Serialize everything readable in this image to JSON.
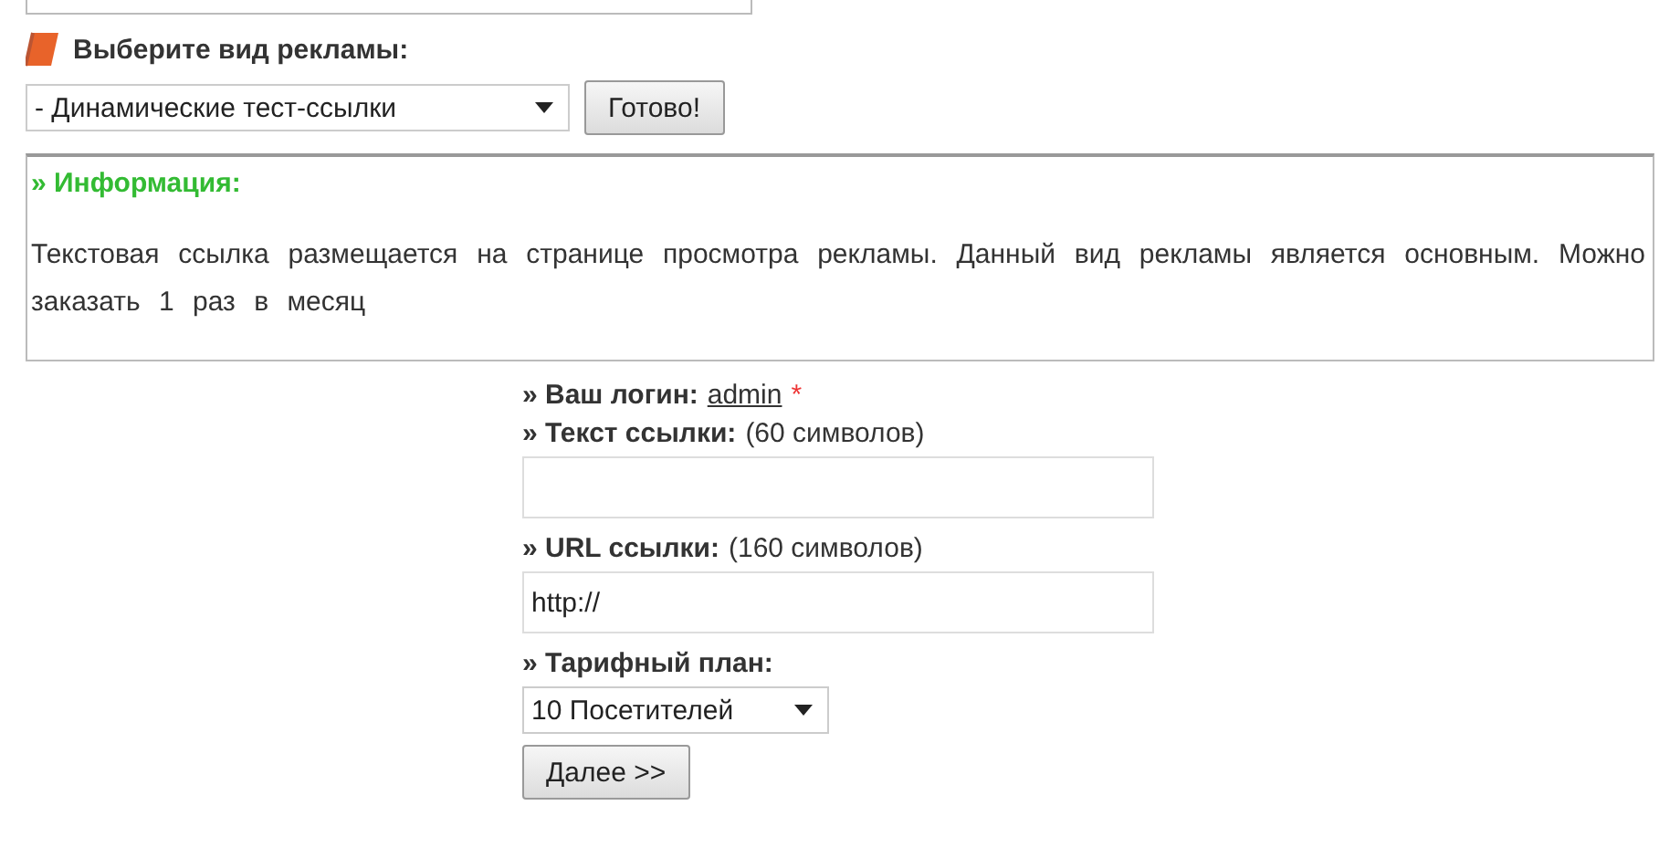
{
  "ad_type": {
    "heading": "Выберите вид рекламы:",
    "select_value": "- Динамические тест-ссылки",
    "button": "Готово!"
  },
  "info": {
    "title": "» Информация:",
    "text": "Текстовая ссылка размещается на странице просмотра рекламы. Данный вид рекламы является основным. Можно заказать 1 раз в месяц"
  },
  "form": {
    "login": {
      "label": "» Ваш логин:",
      "value": "admin",
      "required_mark": "*"
    },
    "fields": [
      {
        "kind": "text",
        "label": "» Текст ссылки:",
        "hint": "(60 символов)"
      },
      {
        "kind": "text",
        "label": "» URL ссылки:",
        "hint": "(160 символов)",
        "value": "http://"
      },
      {
        "kind": "select",
        "label": "» Тарифный план:",
        "value": "10 Посетителей"
      }
    ],
    "submit": "Далее >>"
  }
}
